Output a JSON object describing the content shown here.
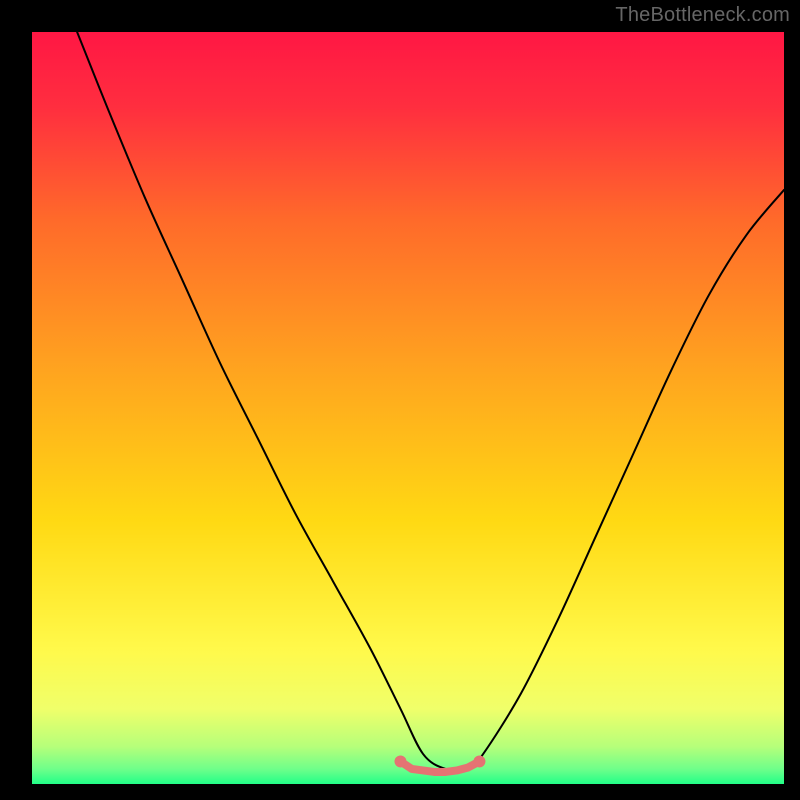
{
  "watermark": "TheBottleneck.com",
  "chart_data": {
    "type": "line",
    "title": "",
    "xlabel": "",
    "ylabel": "",
    "xlim": [
      0,
      100
    ],
    "ylim": [
      0,
      100
    ],
    "grid": false,
    "legend": false,
    "background_gradient": {
      "direction": "vertical",
      "stops": [
        {
          "pos": 0.0,
          "color": "#ff1744"
        },
        {
          "pos": 0.1,
          "color": "#ff2e3f"
        },
        {
          "pos": 0.25,
          "color": "#ff6a2a"
        },
        {
          "pos": 0.45,
          "color": "#ffa41f"
        },
        {
          "pos": 0.65,
          "color": "#ffd913"
        },
        {
          "pos": 0.82,
          "color": "#fff94a"
        },
        {
          "pos": 0.9,
          "color": "#f0ff6a"
        },
        {
          "pos": 0.95,
          "color": "#b6ff7a"
        },
        {
          "pos": 0.98,
          "color": "#6fff8a"
        },
        {
          "pos": 1.0,
          "color": "#22ff88"
        }
      ]
    },
    "series": [
      {
        "name": "bottleneck-curve",
        "color": "#000000",
        "x": [
          6,
          10,
          15,
          20,
          25,
          30,
          35,
          40,
          45,
          49,
          52,
          55,
          58,
          60,
          65,
          70,
          75,
          80,
          85,
          90,
          95,
          100
        ],
        "y": [
          100,
          90,
          78,
          67,
          56,
          46,
          36,
          27,
          18,
          10,
          4,
          2,
          2,
          4,
          12,
          22,
          33,
          44,
          55,
          65,
          73,
          79
        ]
      },
      {
        "name": "optimal-marker",
        "type": "scatter",
        "color": "#e57373",
        "marker_size": 6,
        "x": [
          49,
          50.5,
          52,
          53.5,
          55,
          56.5,
          58,
          59.5
        ],
        "y": [
          3,
          2,
          1.8,
          1.6,
          1.6,
          1.8,
          2.2,
          3
        ]
      }
    ],
    "annotations": []
  }
}
